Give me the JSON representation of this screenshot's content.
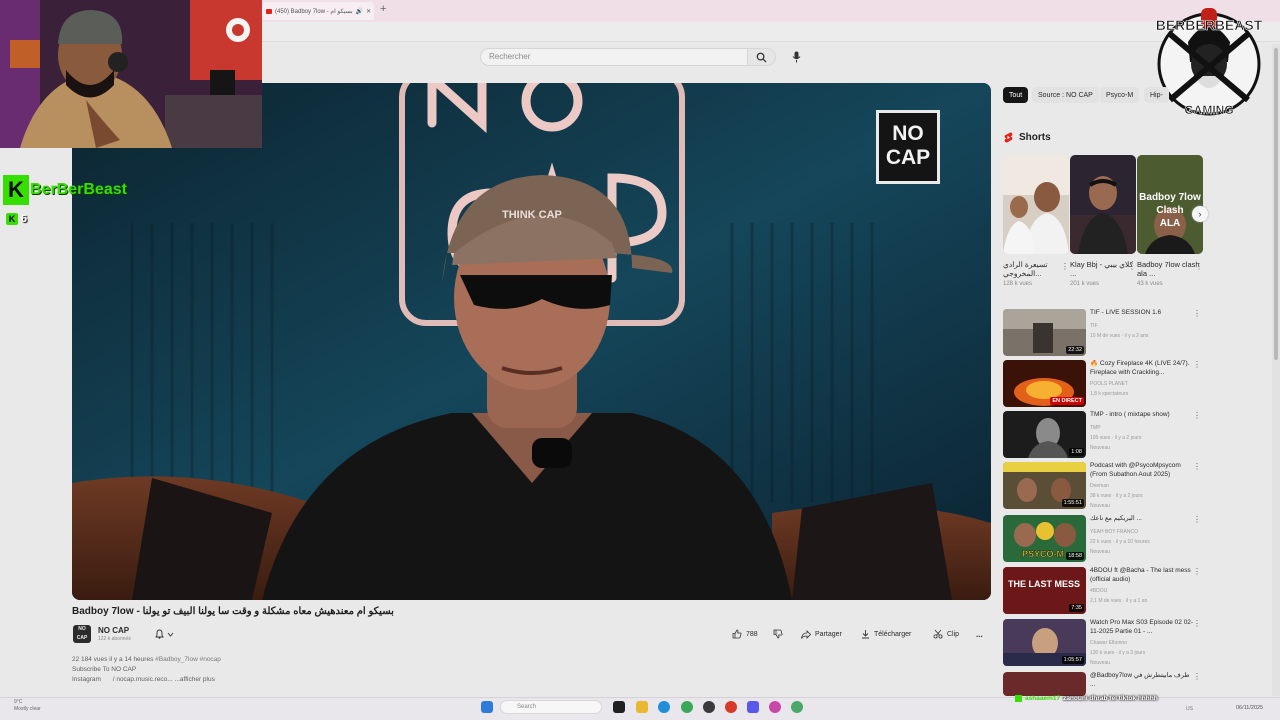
{
  "browser": {
    "tab_title": "(450) Badboy 7low - بسيكو ام",
    "new_tab_glyph": "+"
  },
  "header": {
    "search_placeholder": "Rechercher"
  },
  "player": {
    "watermark_line1": "NO",
    "watermark_line2": "CAP"
  },
  "overlay": {
    "streamer_name": "BerBerBeast",
    "viewer_count": "6",
    "brand_top": "BERBERBEAST",
    "brand_bottom": "GAMING"
  },
  "video": {
    "title": "Badboy 7low - بسيكو ام معندهيش معاه مشكلة و وقت سا يولنا البيف تو يولنا",
    "channel_name": "NO CAP",
    "channel_subs": "122 k abonnés",
    "channel_avatar_text": "NO CAP",
    "likes": "788",
    "share_label": "Partager",
    "download_label": "Télécharger",
    "clip_label": "Clip",
    "more_label": "...",
    "views": "22 184 vues",
    "age": "il y a 14 heures",
    "tags": "#Badboy_7low #nocap",
    "desc_line2": "Subscribe To NO CAP",
    "desc_line3": "Instagram",
    "desc_link": "/ nocap.music.reco...",
    "show_more": "...afficher plus"
  },
  "filters": [
    {
      "label": "Tout",
      "active": true
    },
    {
      "label": "Source : NO CAP",
      "active": false
    },
    {
      "label": "Psyco-M",
      "active": false
    },
    {
      "label": "Hip-",
      "active": false
    }
  ],
  "shorts": {
    "heading": "Shorts",
    "items": [
      {
        "title": "تسيعرة الرادي المخروجي...",
        "views": "128 k vues"
      },
      {
        "title": "Klay Bbj - كلاي بيبي ...",
        "views": "201 k vues"
      },
      {
        "title": "Badboy 7low clash ala ...",
        "views": "43 k vues",
        "thumb_text1": "Badboy 7low",
        "thumb_text2": "Clash",
        "thumb_text3": "ALA"
      }
    ]
  },
  "recommendations": [
    {
      "title": "TIF - LIVE SESSION 1.6",
      "channel": "TIF",
      "meta": "10 M de vues · il y a 2 ans",
      "duration": "22:32",
      "badge": ""
    },
    {
      "title": "🔥 Cozy Fireplace 4K (LIVE 24/7). Fireplace with Crackling...",
      "channel": "POOLS PLANET",
      "meta": "1,8 k spectateurs",
      "duration": "",
      "badge": "EN DIRECT"
    },
    {
      "title": "TMP - intro ( mixtape show)",
      "channel": "TMP",
      "meta": "105 vues · il y a 2 jours",
      "extra": "Nouveau",
      "duration": "1:08",
      "badge": ""
    },
    {
      "title": "Podcast with @PsycoMpsycom (From Subathon Aout 2025)",
      "channel": "Deeman",
      "meta": "38 k vues · il y a 2 jours",
      "extra": "Nouveau",
      "duration": "1:55:51",
      "badge": ""
    },
    {
      "title": "البريكيم مع ناعك ...",
      "channel": "YEAH BOY FRANCO",
      "meta": "22 k vues · il y a 10 heures",
      "extra": "Nouveau",
      "duration": "18:58",
      "badge": "",
      "thumb_text": "PSYCO-M"
    },
    {
      "title": "4BDOU ft @Bacha - The last mess (official audio)",
      "channel": "4BDOU",
      "meta": "2,1 M de vues · il y a 1 an",
      "duration": "7:35",
      "badge": "",
      "thumb_text": "THE LAST MESS"
    },
    {
      "title": "Watch Pro Max S03 Episode 02 02-11-2025 Partie 01 - ...",
      "channel": "Chawar Elbonno",
      "meta": "130 k vues · il y a 3 jours",
      "extra": "Nouveau",
      "duration": "1:05:57",
      "badge": ""
    },
    {
      "title": "@Badboy7low طرف مابيتطرش في ...",
      "channel": "",
      "meta": "",
      "duration": "",
      "badge": ""
    }
  ],
  "taskbar": {
    "weather": "9°C",
    "weather_sub": "Mostly clear",
    "search_label": "Search",
    "time": "06/11/2025"
  },
  "chat": {
    "user": "ashaaem17",
    "message": "zanouni dhrab fel tiktok hhhhh"
  },
  "colors": {
    "accent_red": "#e62117",
    "kick_green": "#35e000",
    "player_bg": "#0f2d3c"
  }
}
